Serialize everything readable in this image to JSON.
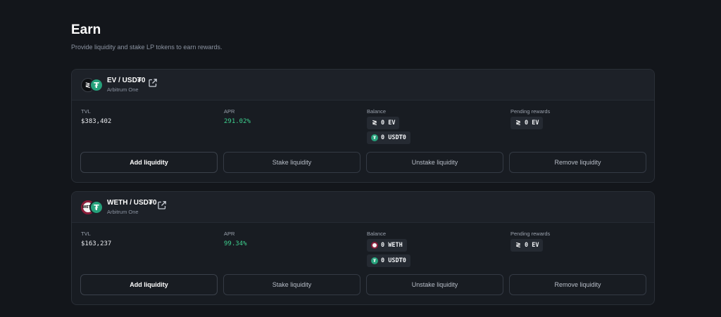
{
  "page": {
    "title": "Earn",
    "subtitle": "Provide liquidity and stake LP tokens to earn rewards."
  },
  "labels": {
    "tvl": "TVL",
    "apr": "APR",
    "balance": "Balance",
    "pending_rewards": "Pending rewards"
  },
  "buttons": {
    "add": "Add liquidity",
    "stake": "Stake liquidity",
    "unstake": "Unstake liquidity",
    "remove": "Remove liquidity"
  },
  "pools": [
    {
      "pair": "EV / USD₮0",
      "chain": "Arbitrum One",
      "icons": [
        "ev-token-icon",
        "usdt-token-icon"
      ],
      "tvl": "$383,402",
      "apr": "291.02%",
      "balances": [
        "0 EV",
        "0 USD₮0"
      ],
      "pending": "0 EV"
    },
    {
      "pair": "WETH / USD₮0",
      "chain": "Arbitrum One",
      "icons": [
        "weth-token-icon",
        "usdt-token-icon"
      ],
      "tvl": "$163,237",
      "apr": "99.34%",
      "balances": [
        "0 WETH",
        "0 USD₮0"
      ],
      "pending": "0 EV"
    }
  ],
  "colors": {
    "background": "#13161b",
    "card": "#181c22",
    "apr_green": "#3ecf8e",
    "usdt_green": "#26a17b",
    "weth_ring": "#8c1d3a"
  }
}
